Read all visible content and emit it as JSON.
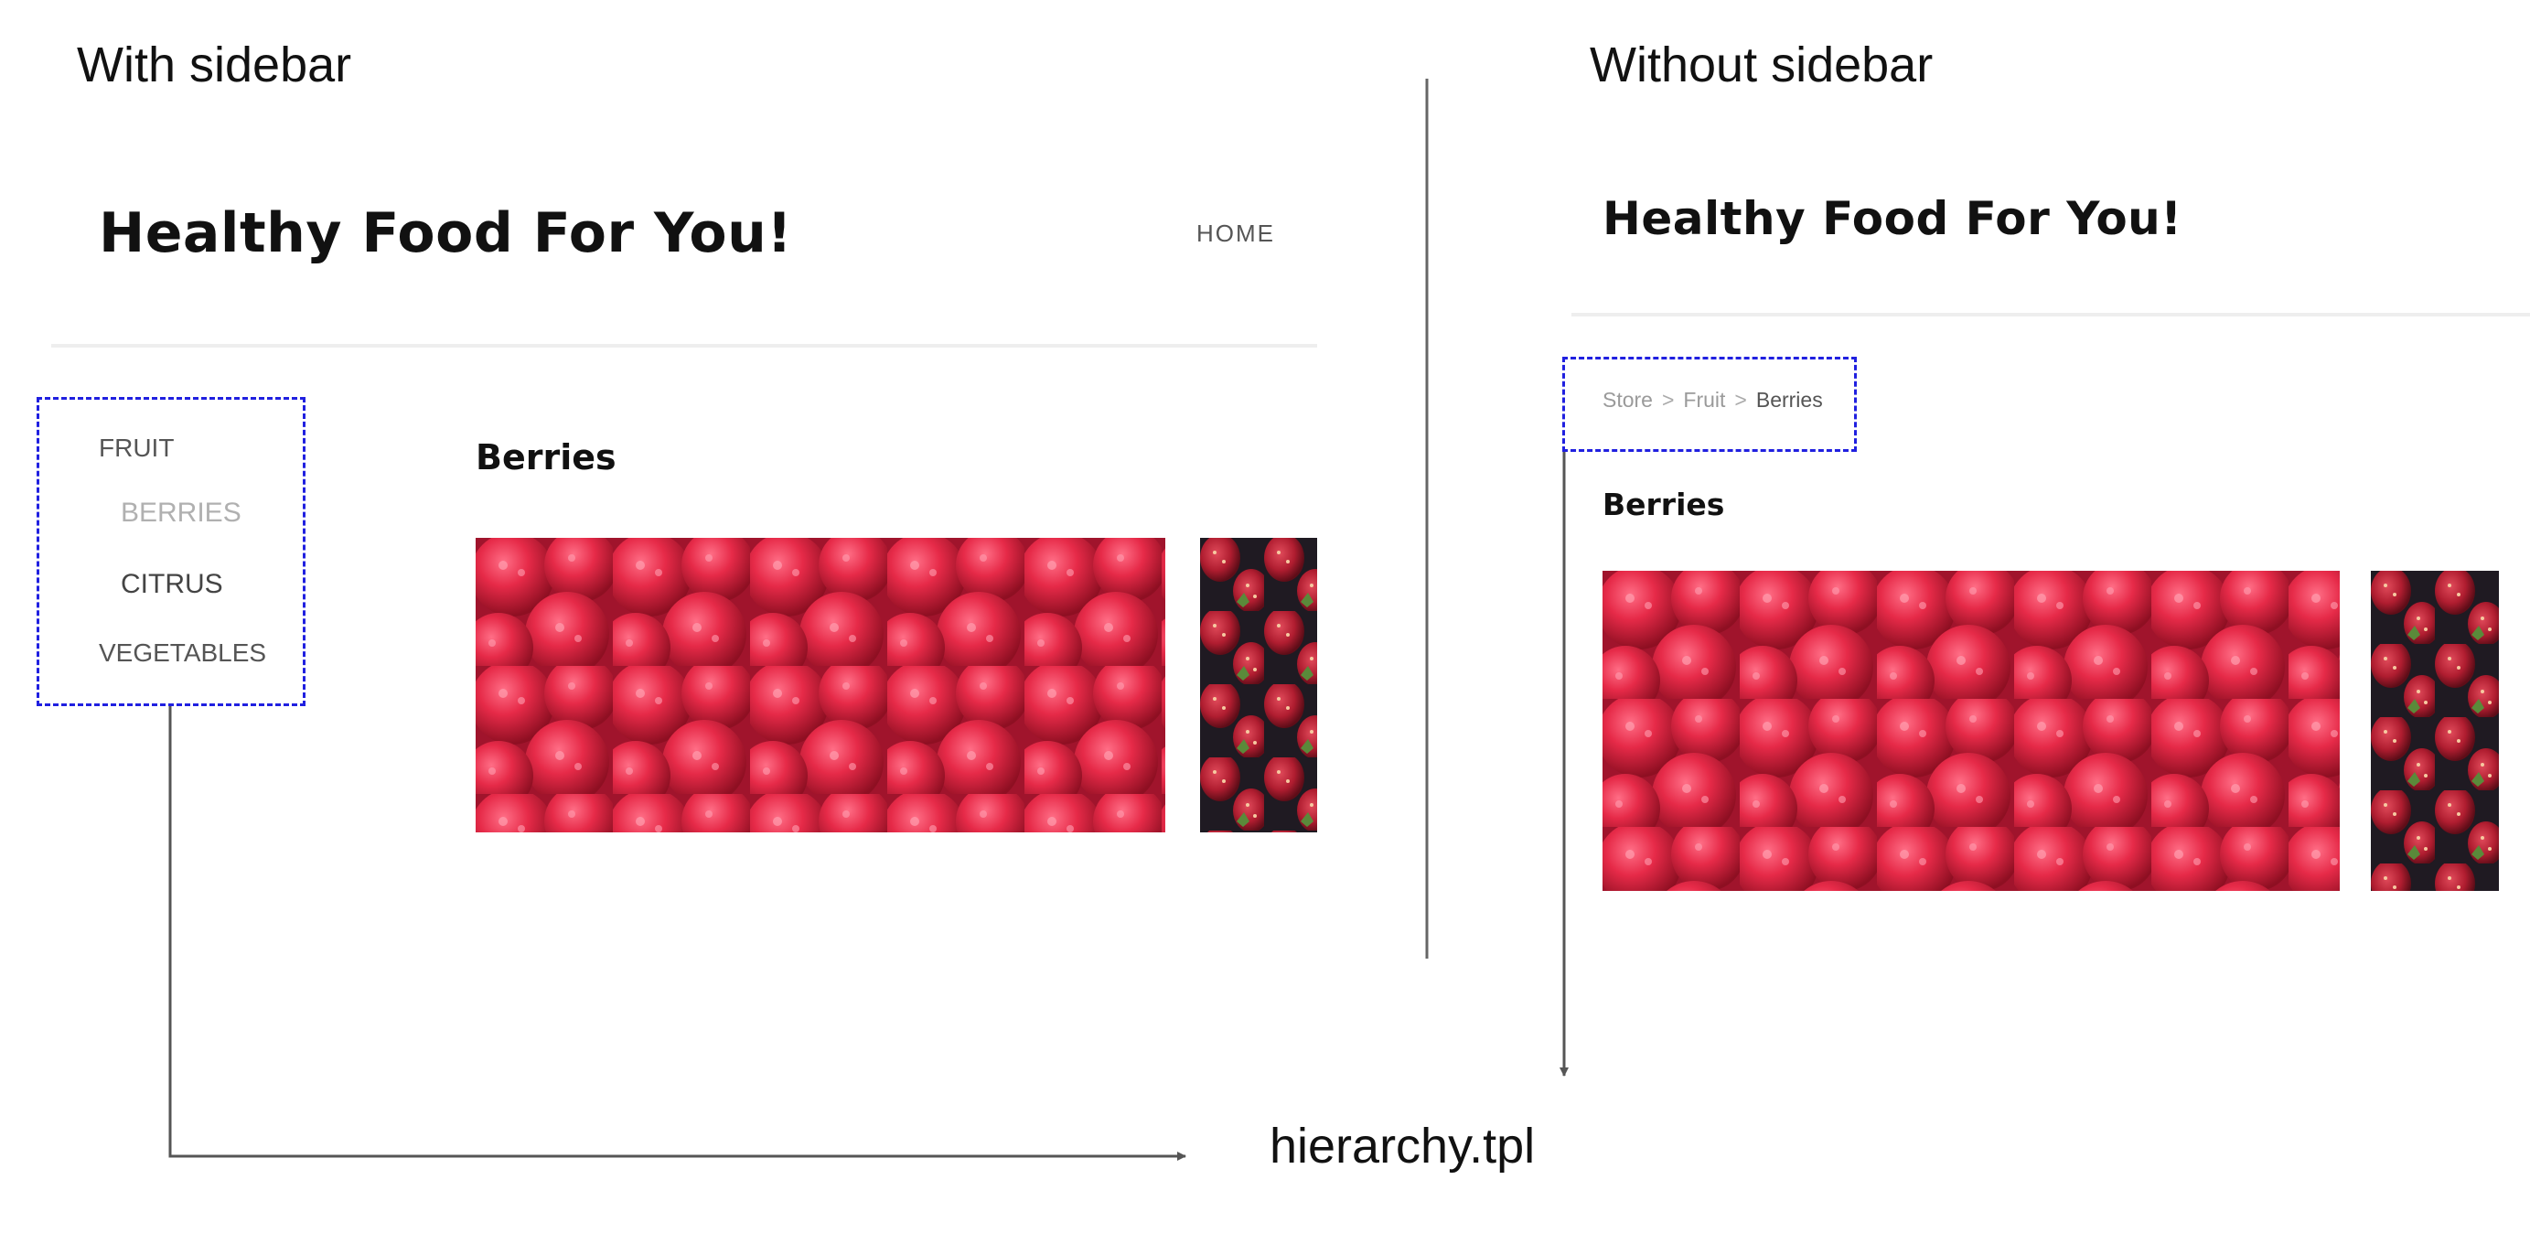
{
  "captions": {
    "with_sidebar": "With sidebar",
    "without_sidebar": "Without sidebar",
    "template_file": "hierarchy.tpl"
  },
  "left_panel": {
    "site_title": "Healthy Food For You!",
    "nav_home": "HOME",
    "sidebar": {
      "items": [
        {
          "label": "FRUIT",
          "state": "parent"
        },
        {
          "label": "BERRIES",
          "state": "active"
        },
        {
          "label": "CITRUS",
          "state": "child"
        },
        {
          "label": "VEGETABLES",
          "state": "parent"
        }
      ]
    },
    "section_title": "Berries"
  },
  "right_panel": {
    "site_title": "Healthy Food For You!",
    "breadcrumb": {
      "items": [
        "Store",
        "Fruit",
        "Berries"
      ],
      "separator": ">"
    },
    "section_title": "Berries"
  },
  "colors": {
    "dashed_box": "#2020e0",
    "arrow": "#555555",
    "divider": "#666666",
    "raspberry": "#d81e3c",
    "strawberry_bg": "#1f1a22"
  },
  "images": {
    "main_photo": "raspberries",
    "side_photo": "strawberries"
  }
}
